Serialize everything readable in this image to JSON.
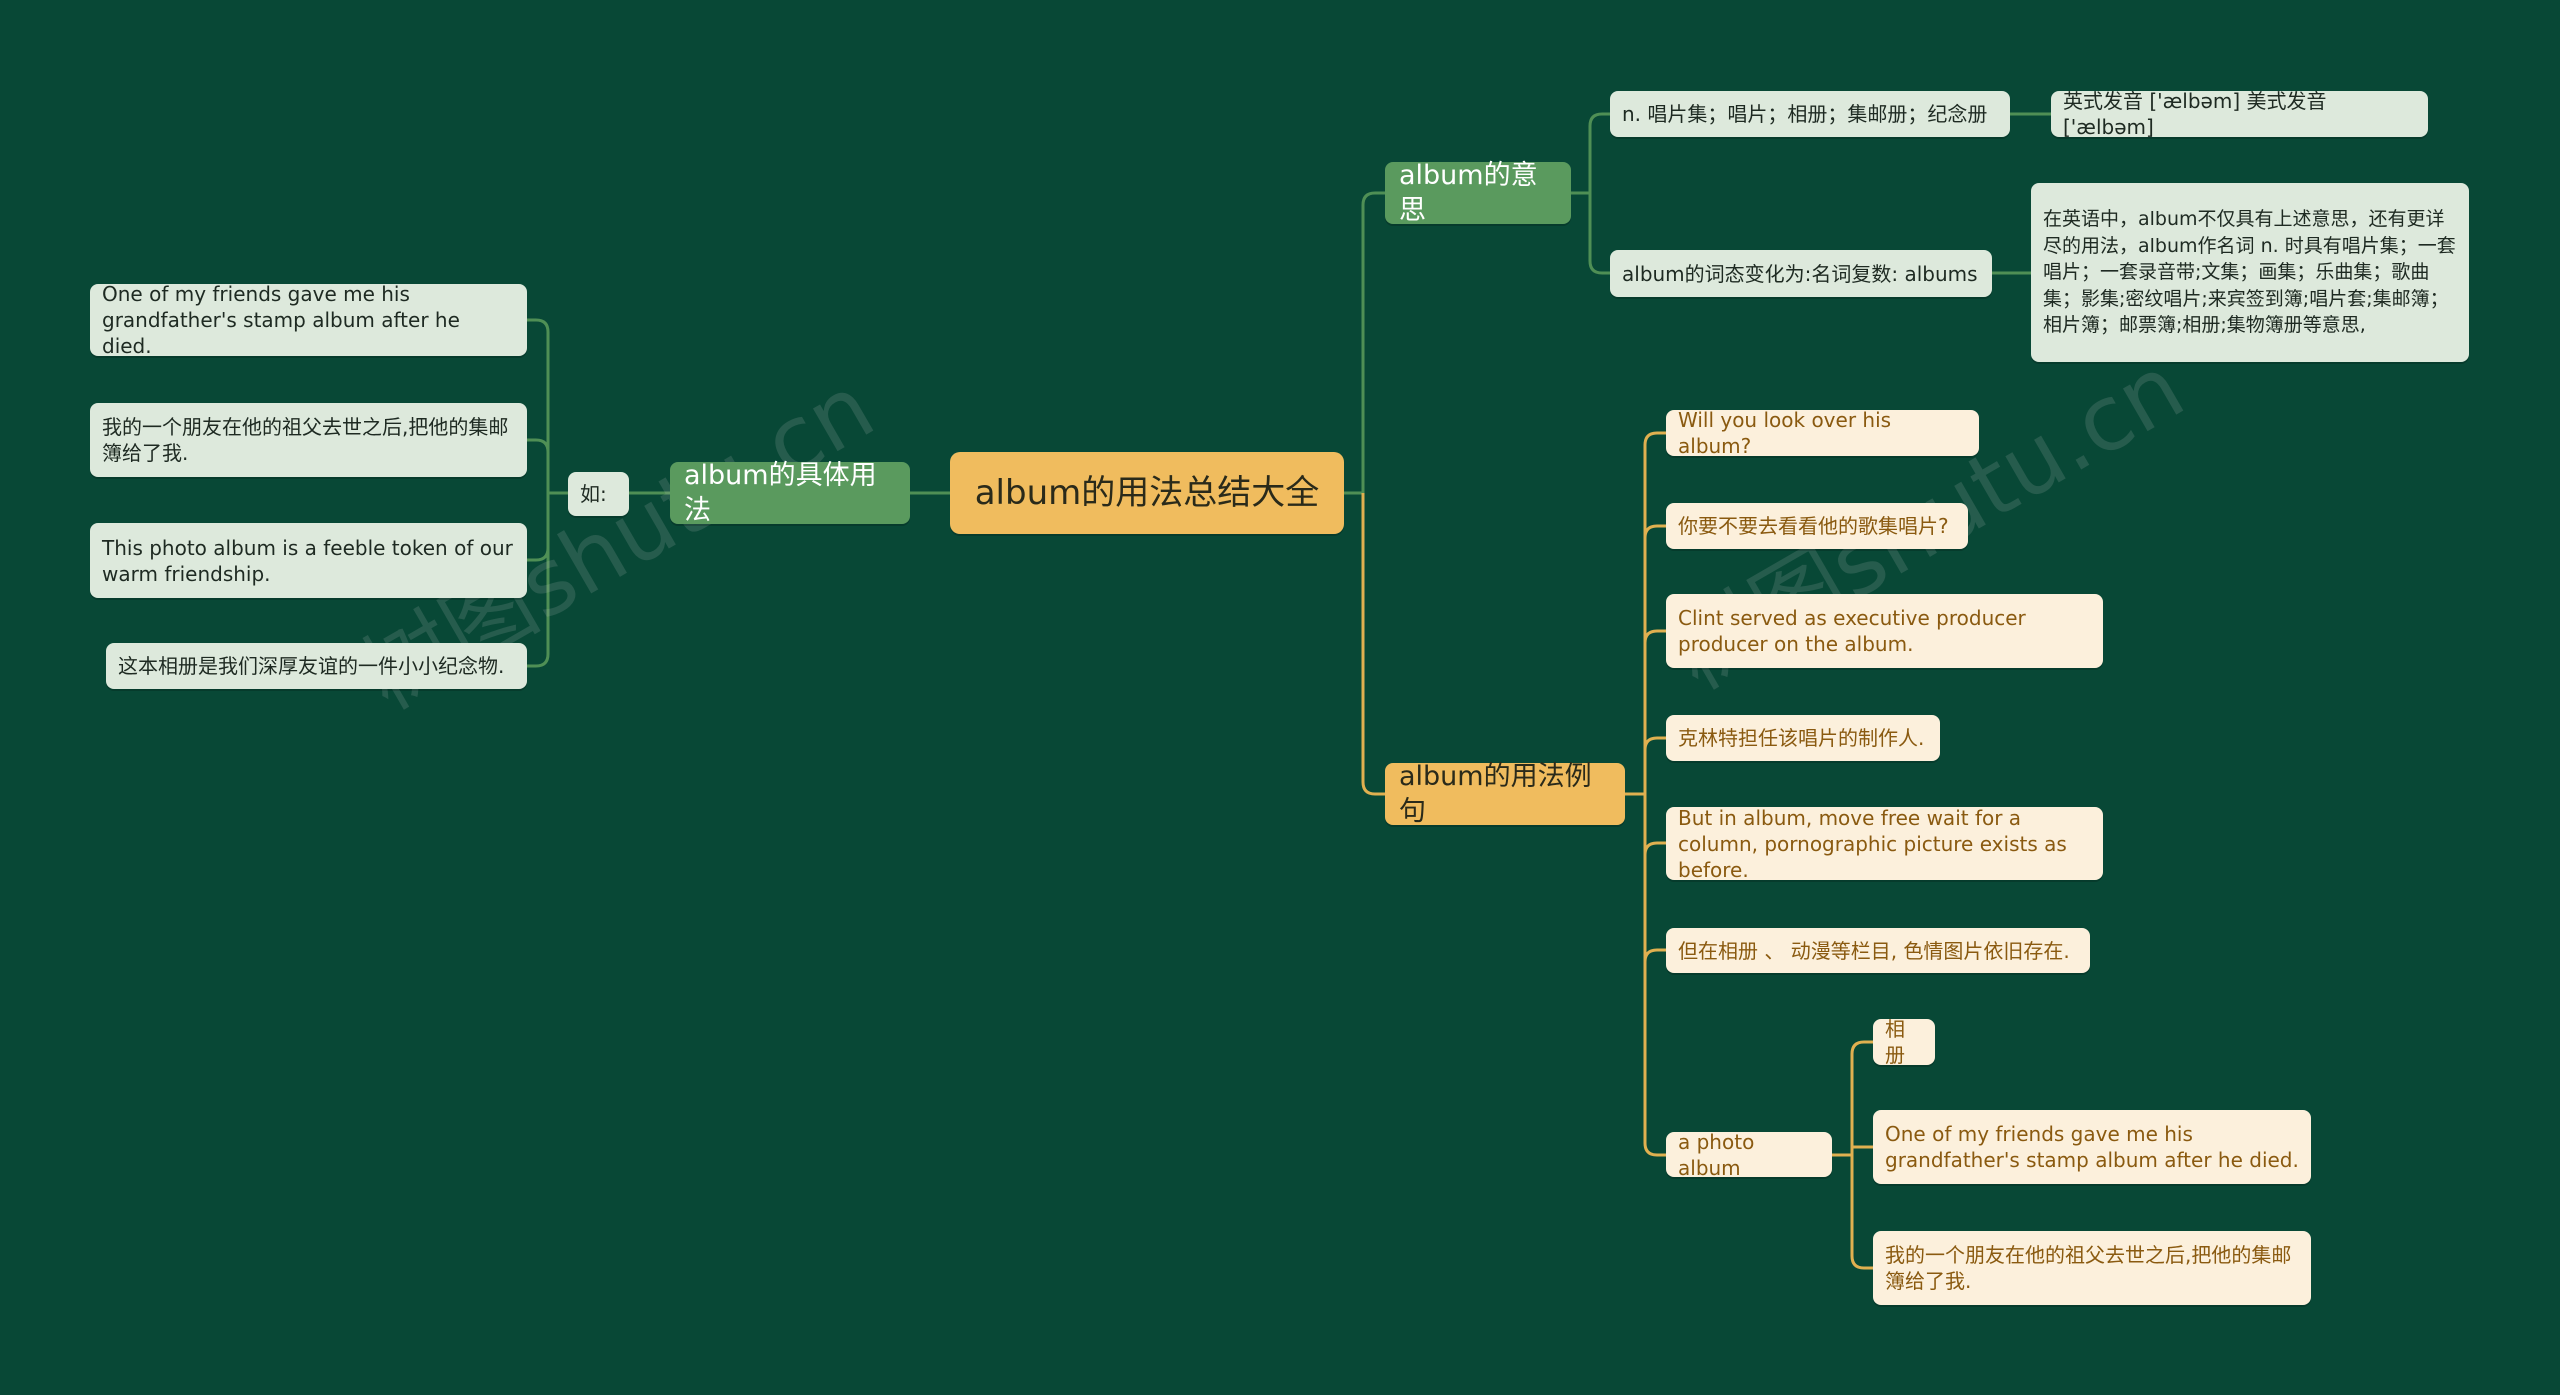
{
  "root": "album的用法总结大全",
  "meaning": {
    "label": "album的意思",
    "definition": "n. 唱片集；唱片；相册；集邮册；纪念册",
    "pronunciation": "英式发音 ['ælbəm] 美式发音 ['ælbəm]",
    "inflection": "album的词态变化为:名词复数: albums",
    "detail": "在英语中，album不仅具有上述意思，还有更详尽的用法，album作名词 n. 时具有唱片集；一套唱片；一套录音带;文集；画集；乐曲集；歌曲集；影集;密纹唱片;来宾签到簿;唱片套;集邮簿；相片簿；邮票簿;相册;集物簿册等意思,"
  },
  "usage": {
    "label": "album的具体用法",
    "prefix": "如:",
    "items": [
      "One of my friends gave me his grandfather's stamp album after he died.",
      "我的一个朋友在他的祖父去世之后,把他的集邮簿给了我.",
      "This photo album is a feeble token of our warm friendship.",
      "这本相册是我们深厚友谊的一件小小纪念物."
    ]
  },
  "examples": {
    "label": "album的用法例句",
    "items": [
      "Will you look over his album?",
      "你要不要去看看他的歌集唱片?",
      "Clint served as executive producer producer on the album.",
      "克林特担任该唱片的制作人.",
      "But in album, move free wait for a column, pornographic picture exists as before.",
      "但在相册 、 动漫等栏目, 色情图片依旧存在.",
      "a photo album"
    ],
    "photo_album_children": [
      "相册",
      "One of my friends gave me his grandfather's stamp album after he died.",
      "我的一个朋友在他的祖父去世之后,把他的集邮簿给了我."
    ]
  },
  "watermark": "树图shutu.cn",
  "colors": {
    "background": "#084836",
    "green_branch": "#5a9a5e",
    "orange_branch": "#f0bc5e",
    "leaf": "#dde9dc",
    "example": "#fcf0dc"
  }
}
